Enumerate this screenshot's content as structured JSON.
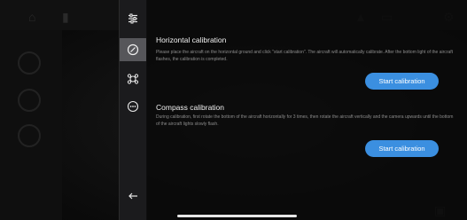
{
  "side_menu": {
    "items": [
      {
        "icon": "sliders-icon",
        "active": false
      },
      {
        "icon": "compass-icon",
        "active": true
      },
      {
        "icon": "drone-icon",
        "active": false
      },
      {
        "icon": "more-dots-icon",
        "active": false
      }
    ],
    "back_icon": "back-arrow-icon"
  },
  "horizontal_calibration": {
    "title": "Horizontal calibration",
    "description": "Please place the aircraft on the horizontal ground and click \"start calibration\". The aircraft will automatically calibrate. After the bottom light of the aircraft flashes, the calibration is completed.",
    "button_label": "Start calibration"
  },
  "compass_calibration": {
    "title": "Compass calibration",
    "description": "During calibration, first rotate the bottom of the aircraft horizontally for 3 times, then rotate the aircraft vertically and the camera upwards until the bottom of the aircraft lights slowly flash.",
    "button_label": "Start calibration"
  },
  "colors": {
    "accent": "#3b8fe0",
    "panel_bg": "#0a0a0a",
    "menu_active": "#56565a"
  }
}
